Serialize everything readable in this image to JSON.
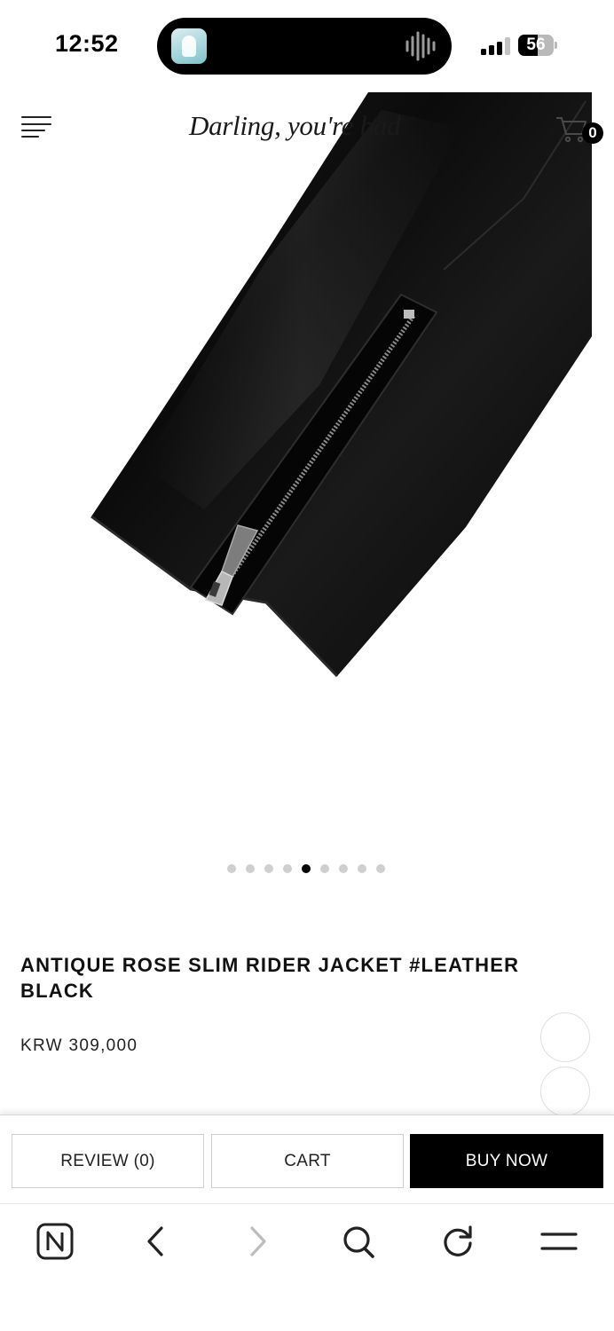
{
  "status_bar": {
    "time": "12:52",
    "battery_level": "56",
    "battery_fraction": 0.56,
    "icons": [
      "app-activity-icon",
      "audio-waveform-icon",
      "cellular-signal-icon",
      "battery-icon"
    ]
  },
  "header": {
    "brand": "Darling, you're bad",
    "cart_count": "0",
    "icons": [
      "hamburger-menu-icon",
      "shopping-cart-icon"
    ]
  },
  "gallery": {
    "image_subject": "black leather jacket sleeve with zipper",
    "total_slides": 9,
    "active_index": 4
  },
  "product": {
    "title": "ANTIQUE ROSE SLIM RIDER JACKET #LEATHER BLACK",
    "price": "KRW 309,000"
  },
  "actions": {
    "review": "REVIEW (0)",
    "cart": "CART",
    "buy_now": "BUY NOW"
  },
  "browser_toolbar": {
    "icons": [
      "naver-home-icon",
      "back-arrow-icon",
      "forward-arrow-icon",
      "search-icon",
      "refresh-icon",
      "menu-icon"
    ]
  },
  "colors": {
    "primary": "#000000",
    "background": "#ffffff",
    "border": "#cfcfcf",
    "inactive_dot": "#cfcfcf"
  }
}
